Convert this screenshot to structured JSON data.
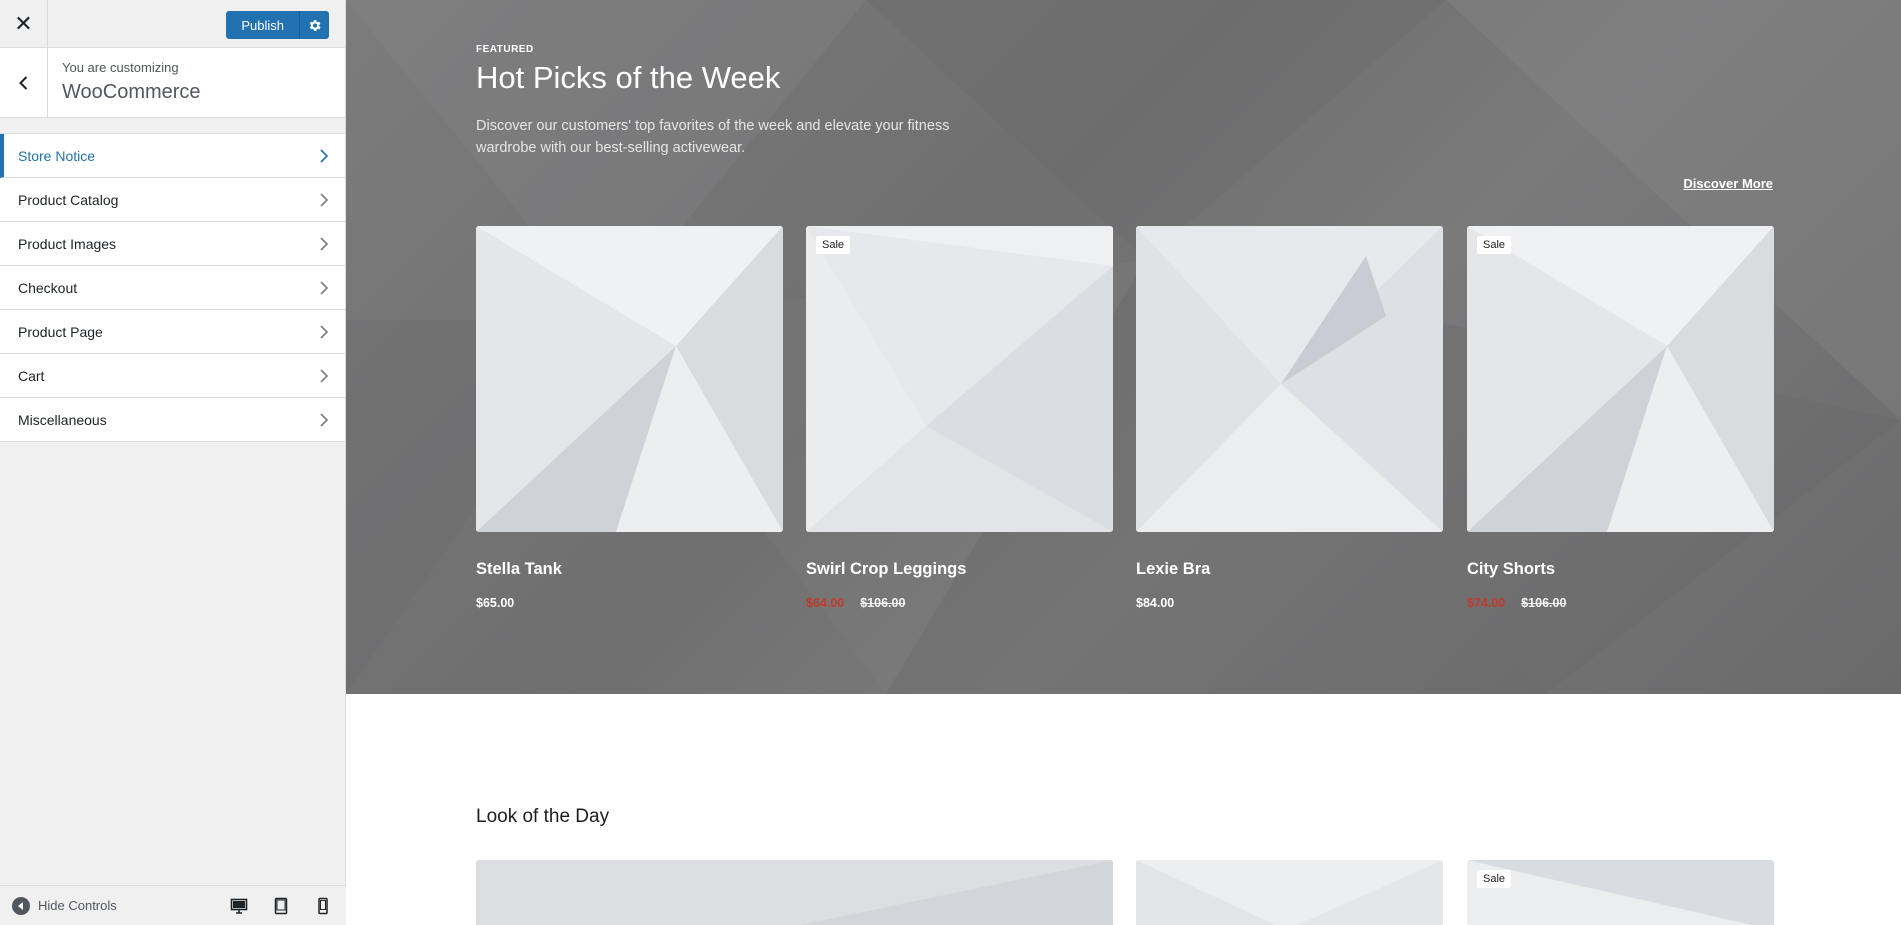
{
  "topbar": {
    "close_icon": "close-icon",
    "publish_label": "Publish",
    "settings_icon": "gear-icon"
  },
  "panel": {
    "subtitle": "You are customizing",
    "title": "WooCommerce"
  },
  "sections": [
    {
      "label": "Store Notice",
      "active": true
    },
    {
      "label": "Product Catalog"
    },
    {
      "label": "Product Images"
    },
    {
      "label": "Checkout"
    },
    {
      "label": "Product Page"
    },
    {
      "label": "Cart"
    },
    {
      "label": "Miscellaneous"
    }
  ],
  "footer": {
    "hide_controls": "Hide Controls",
    "devices": [
      "desktop-icon",
      "tablet-icon",
      "mobile-icon"
    ]
  },
  "hero": {
    "eyebrow": "FEATURED",
    "title": "Hot Picks of the Week",
    "description": "Discover our customers' top favorites of the week and elevate your fitness wardrobe with our best-selling activewear.",
    "discover": "Discover More"
  },
  "products": [
    {
      "name": "Stella Tank",
      "price": "$65.00",
      "sale": false
    },
    {
      "name": "Swirl Crop Leggings",
      "price": "$64.00",
      "old_price": "$106.00",
      "sale": true,
      "badge": "Sale"
    },
    {
      "name": "Lexie Bra",
      "price": "$84.00",
      "sale": false
    },
    {
      "name": "City Shorts",
      "price": "$74.00",
      "old_price": "$106.00",
      "sale": true,
      "badge": "Sale"
    }
  ],
  "look": {
    "title": "Look of the Day",
    "badge": "Sale"
  },
  "colors": {
    "accent": "#2271b1",
    "sale_price": "#c0392b",
    "hero_bg": "#747475"
  }
}
